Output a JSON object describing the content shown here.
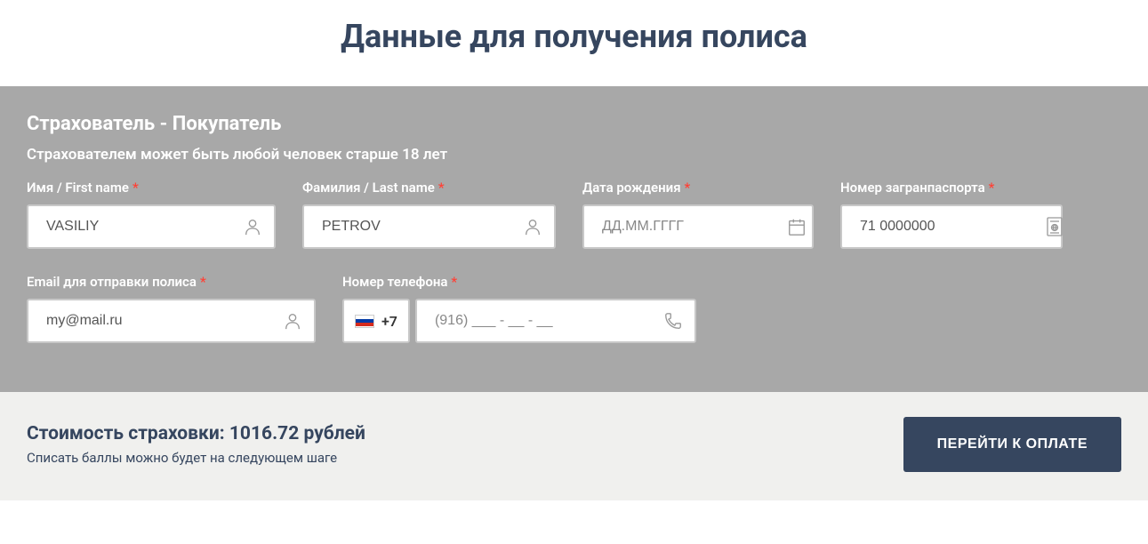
{
  "page_title": "Данные для получения полиса",
  "form": {
    "section_title": "Страхователь - Покупатель",
    "section_subtitle": "Страхователем может быть любой человек старше 18 лет",
    "first_name": {
      "label": "Имя / First name",
      "value": "VASILIY"
    },
    "last_name": {
      "label": "Фамилия / Last name",
      "value": "PETROV"
    },
    "birth_date": {
      "label": "Дата рождения",
      "placeholder": "ДД.ММ.ГГГГ"
    },
    "passport": {
      "label": "Номер загранпаспорта",
      "value": "71 0000000"
    },
    "email": {
      "label": "Email для отправки полиса",
      "value": "my@mail.ru"
    },
    "phone": {
      "label": "Номер телефона",
      "prefix": "+7",
      "placeholder": "(916) ___ - __ - __"
    }
  },
  "footer": {
    "cost_label": "Стоимость страховки:",
    "cost_value": "1016.72",
    "cost_currency": "рублей",
    "note": "Списать баллы можно будет на следующем шаге",
    "pay_button": "ПЕРЕЙТИ К ОПЛАТЕ"
  }
}
